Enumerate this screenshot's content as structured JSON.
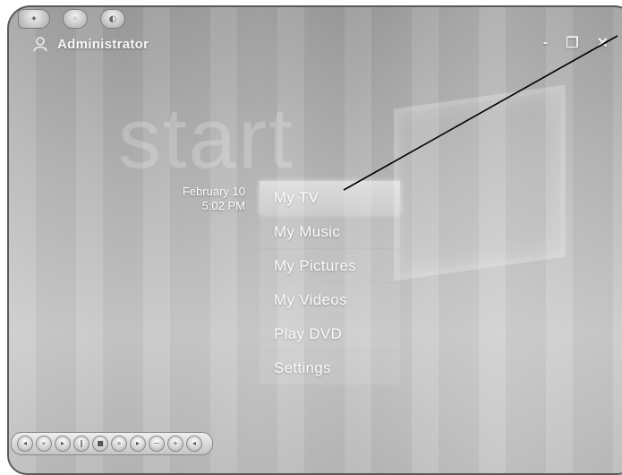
{
  "header": {
    "user_name": "Administrator"
  },
  "background": {
    "watermark_text": "start"
  },
  "clock": {
    "date": "February 10",
    "time": "5:02 PM"
  },
  "menu": {
    "items": [
      {
        "label": "My TV",
        "selected": true
      },
      {
        "label": "My Music",
        "selected": false
      },
      {
        "label": "My Pictures",
        "selected": false
      },
      {
        "label": "My Videos",
        "selected": false
      },
      {
        "label": "Play DVD",
        "selected": false
      },
      {
        "label": "Settings",
        "selected": false
      }
    ]
  },
  "window_controls": {
    "minimize_glyph": "-",
    "restore_glyph": "❐",
    "close_glyph": "✕"
  },
  "icons": {
    "user": "user-icon",
    "top_buttons": [
      "media-center-logo-icon",
      "back-icon",
      "help-icon"
    ],
    "transport": [
      "previous-icon",
      "rewind-icon",
      "play-icon",
      "pause-icon",
      "stop-icon",
      "fast-forward-icon",
      "next-icon",
      "volume-down-icon",
      "volume-up-icon",
      "mute-icon"
    ]
  },
  "colors": {
    "menu_text": "#fbfbfb",
    "selected_highlight": "#e8e8e8",
    "frame_border": "#5a5a5a"
  }
}
